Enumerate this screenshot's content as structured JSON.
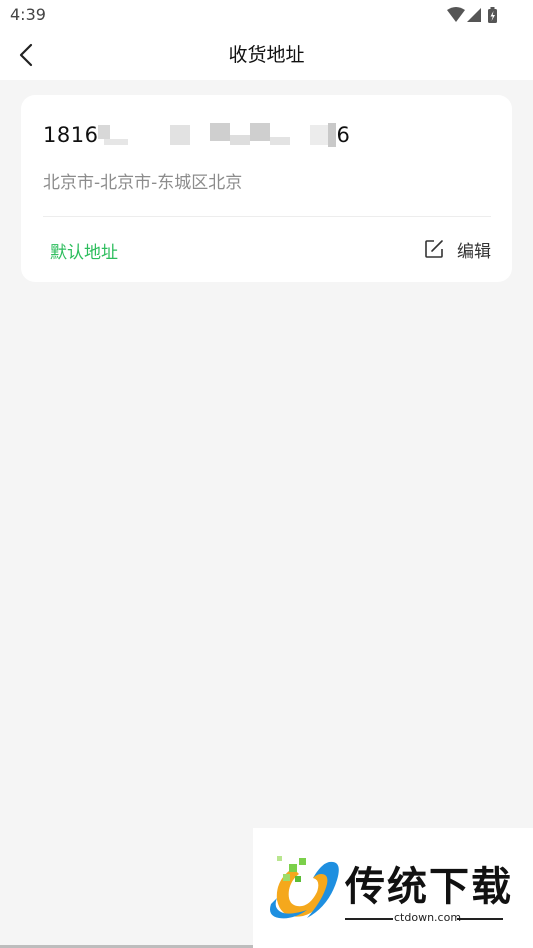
{
  "status_bar": {
    "time": "4:39",
    "icons": [
      "wifi-icon",
      "signal-icon",
      "battery-icon"
    ]
  },
  "header": {
    "back_icon": "chevron-left-icon",
    "title": "收货地址"
  },
  "address_card": {
    "phone_prefix": "1816",
    "phone_suffix": "6",
    "address": "北京市-北京市-东城区北京",
    "default_label": "默认地址",
    "edit_icon": "edit-icon",
    "edit_label": "编辑",
    "accent_color": "#2dbd5d"
  },
  "watermark": {
    "title": "传统下载",
    "url": "ctdown.com"
  }
}
